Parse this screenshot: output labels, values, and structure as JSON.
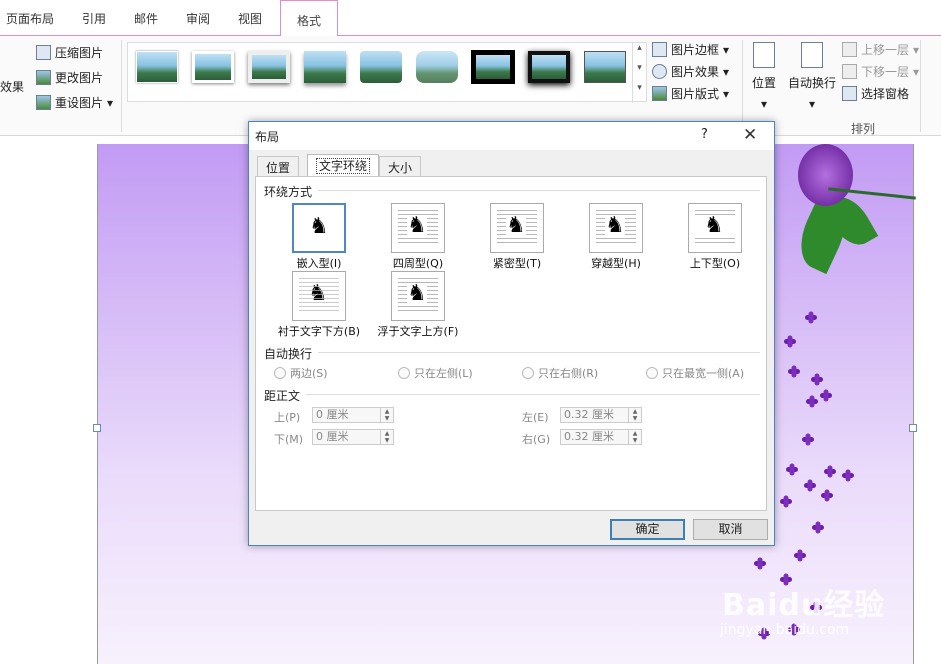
{
  "ribbon": {
    "tabs": [
      "页面布局",
      "引用",
      "邮件",
      "审阅",
      "视图",
      "格式"
    ],
    "left_buttons": [
      "效果",
      "压缩图片",
      "更改图片",
      "重设图片"
    ],
    "picture_buttons": [
      "图片边框",
      "图片效果",
      "图片版式"
    ],
    "position_label": "位置",
    "wrap_label": "自动换行",
    "arrange_buttons": [
      "上移一层",
      "下移一层",
      "选择窗格"
    ],
    "arrange_group_label": "排列",
    "gallery_thumb_count": 9
  },
  "dialog": {
    "title": "布局",
    "help": "?",
    "close": "✕",
    "tabs": [
      "位置",
      "文字环绕",
      "大小"
    ],
    "active_tab": "文字环绕",
    "wrap_section": "环绕方式",
    "wrap_options": [
      "嵌入型(I)",
      "四周型(Q)",
      "紧密型(T)",
      "穿越型(H)",
      "上下型(O)",
      "衬于文字下方(B)",
      "浮于文字上方(F)"
    ],
    "autowrap_section": "自动换行",
    "autowrap_options": [
      "两边(S)",
      "只在左侧(L)",
      "只在右侧(R)",
      "只在最宽一侧(A)"
    ],
    "distance_section": "距正文",
    "distance": {
      "top_label": "上(P)",
      "top_value": "0 厘米",
      "bottom_label": "下(M)",
      "bottom_value": "0 厘米",
      "left_label": "左(E)",
      "left_value": "0.32 厘米",
      "right_label": "右(G)",
      "right_value": "0.32 厘米"
    },
    "ok": "确定",
    "cancel": "取消"
  },
  "watermark": {
    "brand": "Baidu经验",
    "url": "jingyan.baidu.com"
  }
}
